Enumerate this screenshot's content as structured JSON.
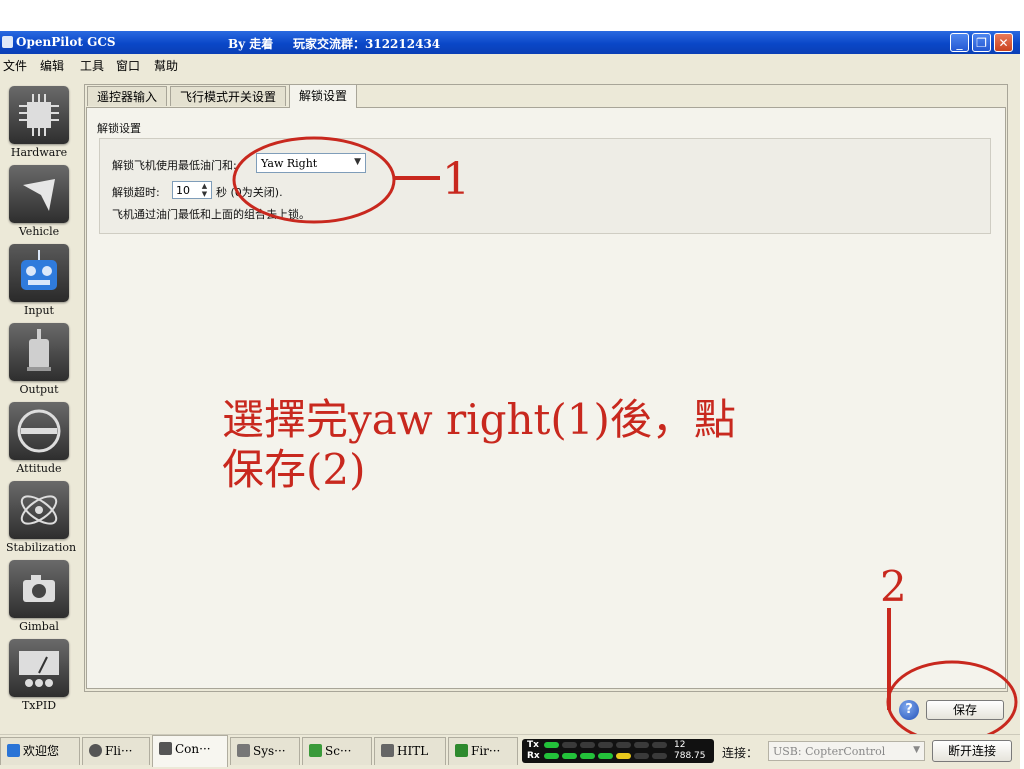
{
  "window": {
    "title": "OpenPilot GCS",
    "title_author": "By 走着",
    "title_group": "玩家交流群：312212434",
    "controls": {
      "minimize": "_",
      "maximize": "❐",
      "close": "✕"
    }
  },
  "menu": {
    "items": [
      "文件",
      "编辑",
      "工具",
      "窗口",
      "幫助"
    ]
  },
  "sidebar": {
    "items": [
      {
        "label": "Hardware",
        "icon": "chip-icon"
      },
      {
        "label": "Vehicle",
        "icon": "aircraft-icon"
      },
      {
        "label": "Input",
        "icon": "transmitter-icon"
      },
      {
        "label": "Output",
        "icon": "motor-icon"
      },
      {
        "label": "Attitude",
        "icon": "level-icon"
      },
      {
        "label": "Stabilization",
        "icon": "gyro-icon"
      },
      {
        "label": "Gimbal",
        "icon": "camera-icon"
      },
      {
        "label": "TxPID",
        "icon": "meter-icon"
      }
    ]
  },
  "tabs": [
    {
      "label": "遥控器输入"
    },
    {
      "label": "飞行模式开关设置"
    },
    {
      "label": "解锁设置"
    }
  ],
  "arming": {
    "section_title": "解锁设置",
    "arm_label": "解锁飞机使用最低油门和:",
    "arm_value": "Yaw Right",
    "timeout_label": "解锁超时:",
    "timeout_value": "10",
    "timeout_suffix": "秒 (0为关闭).",
    "note": "飞机通过油门最低和上面的组合去上锁。"
  },
  "annotations": {
    "marker_1": "1",
    "marker_2": "2",
    "instruction_line1": "選擇完yaw right(1)後，點",
    "instruction_line2": "保存(2)"
  },
  "footer": {
    "help": "?",
    "save_label": "保存"
  },
  "taskbar": {
    "tabs": [
      {
        "label": "欢迎您",
        "icon": "welcome-icon"
      },
      {
        "label": "Fli···",
        "icon": "flight-icon"
      },
      {
        "label": "Con···",
        "icon": "wrench-icon"
      },
      {
        "label": "Sys···",
        "icon": "gears-icon"
      },
      {
        "label": "Sc···",
        "icon": "scope-icon"
      },
      {
        "label": "HITL",
        "icon": "gamepad-icon"
      },
      {
        "label": "Fir···",
        "icon": "firmware-icon"
      }
    ],
    "tx_label": "Tx",
    "rx_label": "Rx",
    "tx_value": "12",
    "rx_value": "788.75",
    "connect_label": "连接：",
    "device": "USB: CopterControl",
    "disconnect_label": "断开连接"
  },
  "colors": {
    "titlebar": "#0a47c8",
    "annotation": "#c8281e",
    "window_bg": "#ece9d8"
  }
}
